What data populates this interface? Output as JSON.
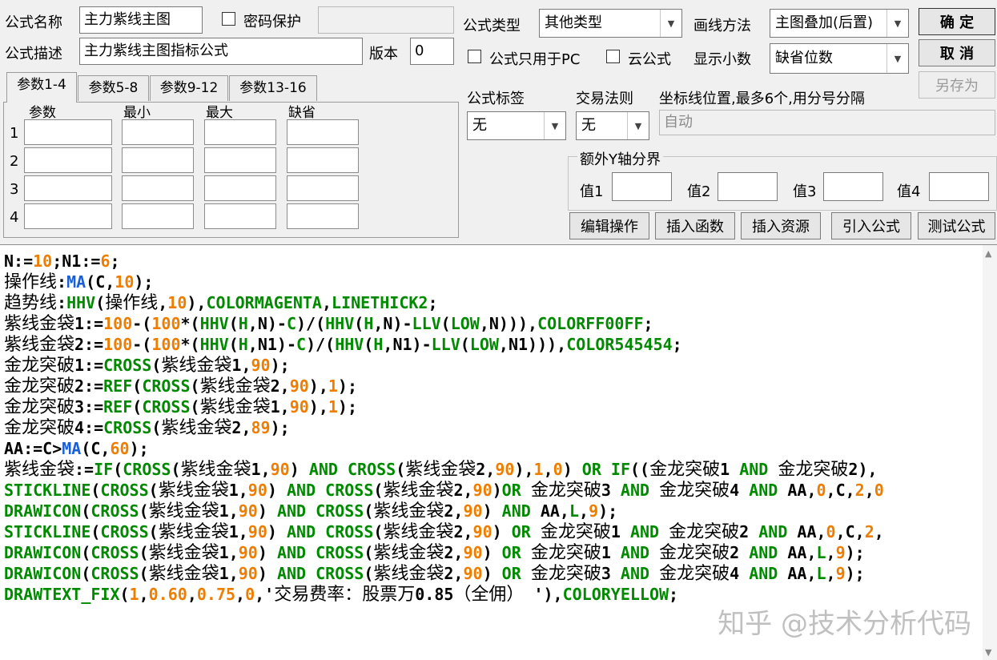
{
  "form": {
    "name_label": "公式名称",
    "name_value": "主力紫线主图",
    "password_label": "密码保护",
    "password_value": "",
    "desc_label": "公式描述",
    "desc_value": "主力紫线主图指标公式",
    "version_label": "版本",
    "version_value": "0"
  },
  "right_panel": {
    "type_label": "公式类型",
    "type_value": "其他类型",
    "draw_label": "画线方法",
    "draw_value": "主图叠加(后置)",
    "pc_only_label": "公式只用于PC",
    "cloud_label": "云公式",
    "decimals_label": "显示小数",
    "decimals_value": "缺省位数",
    "tag_label": "公式标签",
    "tag_value": "无",
    "rule_label": "交易法则",
    "rule_value": "无",
    "axis_label": "坐标线位置,最多6个,用分号分隔",
    "axis_value": "自动",
    "yaxis_group_label": "额外Y轴分界",
    "val1_label": "值1",
    "val2_label": "值2",
    "val3_label": "值3",
    "val4_label": "值4"
  },
  "buttons": {
    "ok": "确  定",
    "cancel": "取  消",
    "save_as": "另存为",
    "edit": "编辑操作",
    "insert_func": "插入函数",
    "insert_res": "插入资源",
    "import": "引入公式",
    "test": "测试公式"
  },
  "tabs": [
    "参数1-4",
    "参数5-8",
    "参数9-12",
    "参数13-16"
  ],
  "params": {
    "headers": [
      "参数",
      "最小",
      "最大",
      "缺省"
    ],
    "rows": [
      "1",
      "2",
      "3",
      "4"
    ]
  },
  "code_lines": [
    [
      [
        "N:=",
        "n"
      ],
      [
        "10",
        "o"
      ],
      [
        ";N1:=",
        "n"
      ],
      [
        "6",
        "o"
      ],
      [
        ";",
        "n"
      ]
    ],
    [
      [
        "操作线",
        "h"
      ],
      [
        ":",
        "n"
      ],
      [
        "MA",
        "c"
      ],
      [
        "(C,",
        "n"
      ],
      [
        "10",
        "o"
      ],
      [
        ");",
        "n"
      ]
    ],
    [
      [
        "趋势线",
        "h"
      ],
      [
        ":",
        "n"
      ],
      [
        "HHV",
        "g"
      ],
      [
        "(",
        "n"
      ],
      [
        "操作线",
        "h"
      ],
      [
        ",",
        "n"
      ],
      [
        "10",
        "o"
      ],
      [
        "),",
        "n"
      ],
      [
        "COLORMAGENTA",
        "g"
      ],
      [
        ",",
        "n"
      ],
      [
        "LINETHICK2",
        "g"
      ],
      [
        ";",
        "n"
      ]
    ],
    [
      [
        "紫线金袋",
        "h"
      ],
      [
        "1:=",
        "n"
      ],
      [
        "100",
        "o"
      ],
      [
        "-(",
        "n"
      ],
      [
        "100",
        "o"
      ],
      [
        "*(",
        "n"
      ],
      [
        "HHV",
        "g"
      ],
      [
        "(",
        "n"
      ],
      [
        "H",
        "g"
      ],
      [
        ",N)-",
        "n"
      ],
      [
        "C",
        "g"
      ],
      [
        ")/(",
        "n"
      ],
      [
        "HHV",
        "g"
      ],
      [
        "(",
        "n"
      ],
      [
        "H",
        "g"
      ],
      [
        ",N)-",
        "n"
      ],
      [
        "LLV",
        "g"
      ],
      [
        "(",
        "n"
      ],
      [
        "LOW",
        "g"
      ],
      [
        ",N))),",
        "n"
      ],
      [
        "COLORFF00FF",
        "g"
      ],
      [
        ";",
        "n"
      ]
    ],
    [
      [
        "紫线金袋",
        "h"
      ],
      [
        "2:=",
        "n"
      ],
      [
        "100",
        "o"
      ],
      [
        "-(",
        "n"
      ],
      [
        "100",
        "o"
      ],
      [
        "*(",
        "n"
      ],
      [
        "HHV",
        "g"
      ],
      [
        "(",
        "n"
      ],
      [
        "H",
        "g"
      ],
      [
        ",N1)-",
        "n"
      ],
      [
        "C",
        "g"
      ],
      [
        ")/(",
        "n"
      ],
      [
        "HHV",
        "g"
      ],
      [
        "(",
        "n"
      ],
      [
        "H",
        "g"
      ],
      [
        ",N1)-",
        "n"
      ],
      [
        "LLV",
        "g"
      ],
      [
        "(",
        "n"
      ],
      [
        "LOW",
        "g"
      ],
      [
        ",N1))),",
        "n"
      ],
      [
        "COLOR545454",
        "g"
      ],
      [
        ";",
        "n"
      ]
    ],
    [
      [
        "金龙突破",
        "h"
      ],
      [
        "1:=",
        "n"
      ],
      [
        "CROSS",
        "g"
      ],
      [
        "(",
        "n"
      ],
      [
        "紫线金袋",
        "h"
      ],
      [
        "1,",
        "n"
      ],
      [
        "90",
        "o"
      ],
      [
        ");",
        "n"
      ]
    ],
    [
      [
        "金龙突破",
        "h"
      ],
      [
        "2:=",
        "n"
      ],
      [
        "REF",
        "g"
      ],
      [
        "(",
        "n"
      ],
      [
        "CROSS",
        "g"
      ],
      [
        "(",
        "n"
      ],
      [
        "紫线金袋",
        "h"
      ],
      [
        "2,",
        "n"
      ],
      [
        "90",
        "o"
      ],
      [
        "),",
        "n"
      ],
      [
        "1",
        "o"
      ],
      [
        ");",
        "n"
      ]
    ],
    [
      [
        "金龙突破",
        "h"
      ],
      [
        "3:=",
        "n"
      ],
      [
        "REF",
        "g"
      ],
      [
        "(",
        "n"
      ],
      [
        "CROSS",
        "g"
      ],
      [
        "(",
        "n"
      ],
      [
        "紫线金袋",
        "h"
      ],
      [
        "1,",
        "n"
      ],
      [
        "90",
        "o"
      ],
      [
        "),",
        "n"
      ],
      [
        "1",
        "o"
      ],
      [
        ");",
        "n"
      ]
    ],
    [
      [
        "金龙突破",
        "h"
      ],
      [
        "4:=",
        "n"
      ],
      [
        "CROSS",
        "g"
      ],
      [
        "(",
        "n"
      ],
      [
        "紫线金袋",
        "h"
      ],
      [
        "2,",
        "n"
      ],
      [
        "89",
        "o"
      ],
      [
        ");",
        "n"
      ]
    ],
    [
      [
        "AA:=C>",
        "n"
      ],
      [
        "MA",
        "c"
      ],
      [
        "(C,",
        "n"
      ],
      [
        "60",
        "o"
      ],
      [
        ");",
        "n"
      ]
    ],
    [
      [
        "紫线金袋",
        "h"
      ],
      [
        ":=",
        "n"
      ],
      [
        "IF",
        "g"
      ],
      [
        "(",
        "n"
      ],
      [
        "CROSS",
        "g"
      ],
      [
        "(",
        "n"
      ],
      [
        "紫线金袋",
        "h"
      ],
      [
        "1,",
        "n"
      ],
      [
        "90",
        "o"
      ],
      [
        ") ",
        "n"
      ],
      [
        "AND",
        "g"
      ],
      [
        " ",
        "n"
      ],
      [
        "CROSS",
        "g"
      ],
      [
        "(",
        "n"
      ],
      [
        "紫线金袋",
        "h"
      ],
      [
        "2,",
        "n"
      ],
      [
        "90",
        "o"
      ],
      [
        "),",
        "n"
      ],
      [
        "1",
        "o"
      ],
      [
        ",",
        "n"
      ],
      [
        "0",
        "o"
      ],
      [
        ") ",
        "n"
      ],
      [
        "OR",
        "g"
      ],
      [
        " ",
        "n"
      ],
      [
        "IF",
        "g"
      ],
      [
        "((",
        "n"
      ],
      [
        "金龙突破",
        "h"
      ],
      [
        "1 ",
        "n"
      ],
      [
        "AND",
        "g"
      ],
      [
        " ",
        "n"
      ],
      [
        "金龙突破",
        "h"
      ],
      [
        "2),",
        "n"
      ]
    ],
    [
      [
        "STICKLINE",
        "g"
      ],
      [
        "(",
        "n"
      ],
      [
        "CROSS",
        "g"
      ],
      [
        "(",
        "n"
      ],
      [
        "紫线金袋",
        "h"
      ],
      [
        "1,",
        "n"
      ],
      [
        "90",
        "o"
      ],
      [
        ") ",
        "n"
      ],
      [
        "AND",
        "g"
      ],
      [
        " ",
        "n"
      ],
      [
        "CROSS",
        "g"
      ],
      [
        "(",
        "n"
      ],
      [
        "紫线金袋",
        "h"
      ],
      [
        "2,",
        "n"
      ],
      [
        "90",
        "o"
      ],
      [
        ")",
        "n"
      ],
      [
        "OR",
        "g"
      ],
      [
        " ",
        "n"
      ],
      [
        "金龙突破",
        "h"
      ],
      [
        "3 ",
        "n"
      ],
      [
        "AND",
        "g"
      ],
      [
        " ",
        "n"
      ],
      [
        "金龙突破",
        "h"
      ],
      [
        "4 ",
        "n"
      ],
      [
        "AND",
        "g"
      ],
      [
        " AA,",
        "n"
      ],
      [
        "0",
        "o"
      ],
      [
        ",C,",
        "n"
      ],
      [
        "2",
        "o"
      ],
      [
        ",",
        "n"
      ],
      [
        "0",
        "o"
      ]
    ],
    [
      [
        "DRAWICON",
        "g"
      ],
      [
        "(",
        "n"
      ],
      [
        "CROSS",
        "g"
      ],
      [
        "(",
        "n"
      ],
      [
        "紫线金袋",
        "h"
      ],
      [
        "1,",
        "n"
      ],
      [
        "90",
        "o"
      ],
      [
        ") ",
        "n"
      ],
      [
        "AND",
        "g"
      ],
      [
        " ",
        "n"
      ],
      [
        "CROSS",
        "g"
      ],
      [
        "(",
        "n"
      ],
      [
        "紫线金袋",
        "h"
      ],
      [
        "2,",
        "n"
      ],
      [
        "90",
        "o"
      ],
      [
        ") ",
        "n"
      ],
      [
        "AND",
        "g"
      ],
      [
        " AA,",
        "n"
      ],
      [
        "L",
        "g"
      ],
      [
        ",",
        "n"
      ],
      [
        "9",
        "o"
      ],
      [
        ");",
        "n"
      ]
    ],
    [
      [
        "STICKLINE",
        "g"
      ],
      [
        "(",
        "n"
      ],
      [
        "CROSS",
        "g"
      ],
      [
        "(",
        "n"
      ],
      [
        "紫线金袋",
        "h"
      ],
      [
        "1,",
        "n"
      ],
      [
        "90",
        "o"
      ],
      [
        ") ",
        "n"
      ],
      [
        "AND",
        "g"
      ],
      [
        " ",
        "n"
      ],
      [
        "CROSS",
        "g"
      ],
      [
        "(",
        "n"
      ],
      [
        "紫线金袋",
        "h"
      ],
      [
        "2,",
        "n"
      ],
      [
        "90",
        "o"
      ],
      [
        ") ",
        "n"
      ],
      [
        "OR",
        "g"
      ],
      [
        " ",
        "n"
      ],
      [
        "金龙突破",
        "h"
      ],
      [
        "1 ",
        "n"
      ],
      [
        "AND",
        "g"
      ],
      [
        " ",
        "n"
      ],
      [
        "金龙突破",
        "h"
      ],
      [
        "2 ",
        "n"
      ],
      [
        "AND",
        "g"
      ],
      [
        " AA,",
        "n"
      ],
      [
        "0",
        "o"
      ],
      [
        ",C,",
        "n"
      ],
      [
        "2",
        "o"
      ],
      [
        ",",
        "n"
      ]
    ],
    [
      [
        "DRAWICON",
        "g"
      ],
      [
        "(",
        "n"
      ],
      [
        "CROSS",
        "g"
      ],
      [
        "(",
        "n"
      ],
      [
        "紫线金袋",
        "h"
      ],
      [
        "1,",
        "n"
      ],
      [
        "90",
        "o"
      ],
      [
        ") ",
        "n"
      ],
      [
        "AND",
        "g"
      ],
      [
        " ",
        "n"
      ],
      [
        "CROSS",
        "g"
      ],
      [
        "(",
        "n"
      ],
      [
        "紫线金袋",
        "h"
      ],
      [
        "2,",
        "n"
      ],
      [
        "90",
        "o"
      ],
      [
        ") ",
        "n"
      ],
      [
        "OR",
        "g"
      ],
      [
        " ",
        "n"
      ],
      [
        "金龙突破",
        "h"
      ],
      [
        "1 ",
        "n"
      ],
      [
        "AND",
        "g"
      ],
      [
        " ",
        "n"
      ],
      [
        "金龙突破",
        "h"
      ],
      [
        "2 ",
        "n"
      ],
      [
        "AND",
        "g"
      ],
      [
        " AA,",
        "n"
      ],
      [
        "L",
        "g"
      ],
      [
        ",",
        "n"
      ],
      [
        "9",
        "o"
      ],
      [
        ");",
        "n"
      ]
    ],
    [
      [
        "DRAWICON",
        "g"
      ],
      [
        "(",
        "n"
      ],
      [
        "CROSS",
        "g"
      ],
      [
        "(",
        "n"
      ],
      [
        "紫线金袋",
        "h"
      ],
      [
        "1,",
        "n"
      ],
      [
        "90",
        "o"
      ],
      [
        ") ",
        "n"
      ],
      [
        "AND",
        "g"
      ],
      [
        " ",
        "n"
      ],
      [
        "CROSS",
        "g"
      ],
      [
        "(",
        "n"
      ],
      [
        "紫线金袋",
        "h"
      ],
      [
        "2,",
        "n"
      ],
      [
        "90",
        "o"
      ],
      [
        ") ",
        "n"
      ],
      [
        "OR",
        "g"
      ],
      [
        " ",
        "n"
      ],
      [
        "金龙突破",
        "h"
      ],
      [
        "3 ",
        "n"
      ],
      [
        "AND",
        "g"
      ],
      [
        " ",
        "n"
      ],
      [
        "金龙突破",
        "h"
      ],
      [
        "4 ",
        "n"
      ],
      [
        "AND",
        "g"
      ],
      [
        " AA,",
        "n"
      ],
      [
        "L",
        "g"
      ],
      [
        ",",
        "n"
      ],
      [
        "9",
        "o"
      ],
      [
        ");",
        "n"
      ]
    ],
    [
      [
        "DRAWTEXT_FIX",
        "g"
      ],
      [
        "(",
        "n"
      ],
      [
        "1",
        "o"
      ],
      [
        ",",
        "n"
      ],
      [
        "0.60",
        "o"
      ],
      [
        ",",
        "n"
      ],
      [
        "0.75",
        "o"
      ],
      [
        ",",
        "n"
      ],
      [
        "0",
        "o"
      ],
      [
        ",'",
        "n"
      ],
      [
        "交易费率：股票万",
        "h"
      ],
      [
        "0.85",
        "n"
      ],
      [
        "（全佣）",
        "h"
      ],
      [
        " '),",
        "n"
      ],
      [
        "COLORYELLOW",
        "g"
      ],
      [
        ";",
        "n"
      ]
    ]
  ],
  "watermark": "知乎 @技术分析代码",
  "colors": {
    "code_default": "#000000",
    "code_number": "#ee7d00",
    "code_function": "#008a00",
    "code_ma": "#1a5fd6"
  }
}
